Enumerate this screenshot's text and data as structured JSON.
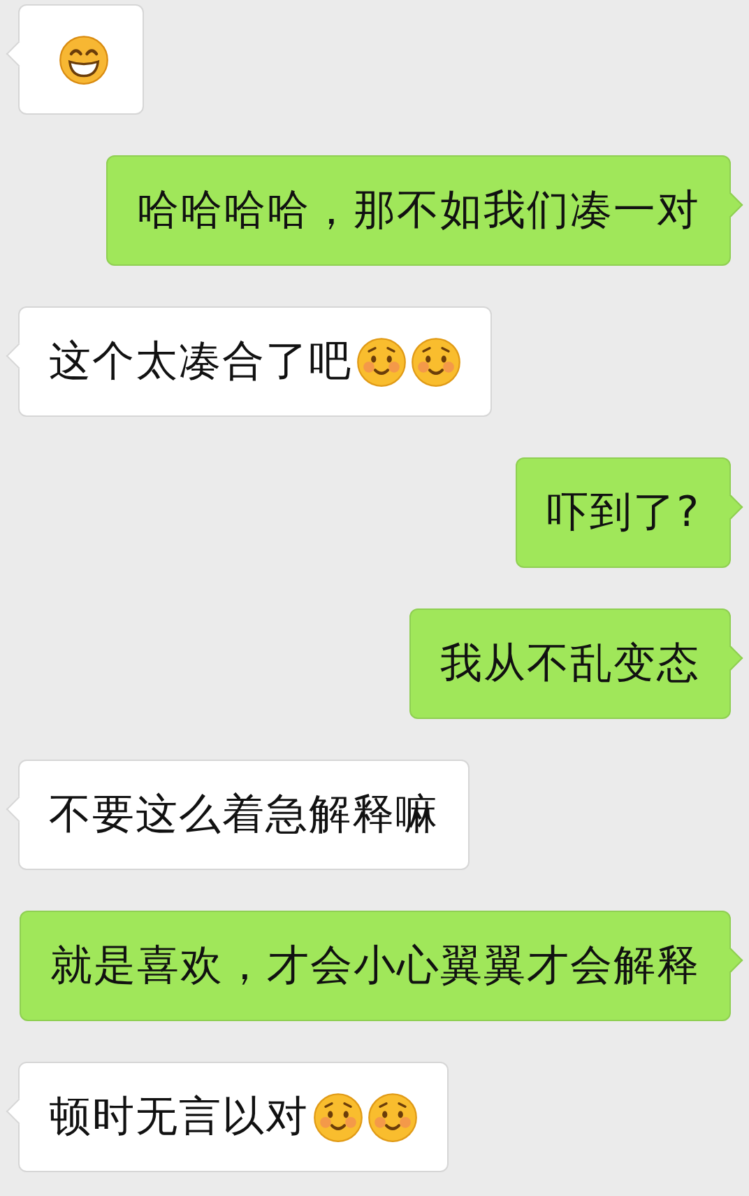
{
  "messages": [
    {
      "outgoing": false,
      "emojis": [
        {
          "kind": "grin"
        }
      ]
    },
    {
      "outgoing": true,
      "text": "哈哈哈哈，那不如我们凑一对"
    },
    {
      "outgoing": false,
      "text": "这个太凑合了吧",
      "emojis": [
        {
          "kind": "blush"
        },
        {
          "kind": "blush"
        }
      ]
    },
    {
      "outgoing": true,
      "text": "吓到了?"
    },
    {
      "outgoing": true,
      "text": "我从不乱变态"
    },
    {
      "outgoing": false,
      "text": "不要这么着急解释嘛"
    },
    {
      "outgoing": true,
      "text": "就是喜欢，才会小心翼翼才会解释"
    },
    {
      "outgoing": false,
      "text": "顿时无言以对",
      "emojis": [
        {
          "kind": "blush"
        },
        {
          "kind": "blush"
        }
      ]
    }
  ]
}
